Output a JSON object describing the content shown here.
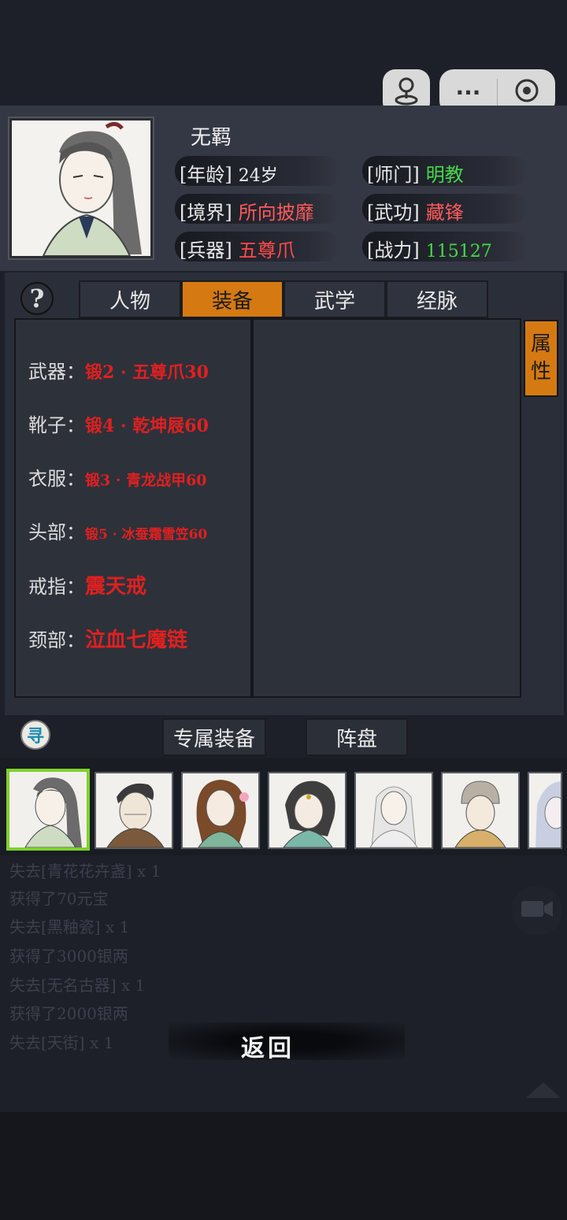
{
  "icons": {
    "location": "location-pin-icon",
    "more": "more-dots-icon",
    "close": "target-circle-icon",
    "help": "question-mark-icon",
    "search": "xun-search-icon",
    "camera": "camera-icon"
  },
  "capsule": {
    "more_glyph": "···"
  },
  "profile": {
    "name": "无羁",
    "rows": [
      {
        "label": "[年龄]",
        "value": "24岁",
        "color": "#f0f0f0"
      },
      {
        "label": "[师门]",
        "value": "明教",
        "color": "#47d84a"
      },
      {
        "label": "[境界]",
        "value": "所向披靡",
        "color": "#ff5a5a"
      },
      {
        "label": "[武功]",
        "value": "藏锋",
        "color": "#ff5a5a"
      },
      {
        "label": "[兵器]",
        "value": "五尊爪",
        "color": "#ff4a4a"
      },
      {
        "label": "[战力]",
        "value": "115127",
        "color": "#47d84a"
      }
    ]
  },
  "help_glyph": "?",
  "tabs": [
    {
      "label": "人物",
      "active": false
    },
    {
      "label": "装备",
      "active": true
    },
    {
      "label": "武学",
      "active": false
    },
    {
      "label": "经脉",
      "active": false
    }
  ],
  "attr_tab": [
    "属",
    "性"
  ],
  "equipment": [
    {
      "label": "武器：",
      "value": "锻2 · 五尊爪30"
    },
    {
      "label": "靴子：",
      "value": "锻4 · 乾坤屐60"
    },
    {
      "label": "衣服：",
      "value": "锻3 · 青龙战甲60"
    },
    {
      "label": "头部：",
      "value": "锻5 · 冰蚕霜雪笠60"
    },
    {
      "label": "戒指：",
      "value": "震天戒"
    },
    {
      "label": "颈部：",
      "value": "泣血七魔链"
    }
  ],
  "search_glyph": "寻",
  "sub_tabs": [
    "专属装备",
    "阵盘"
  ],
  "roster_selected": 0,
  "log": [
    "失去[青花花卉盏] x 1",
    "获得了70元宝",
    "失去[黑釉瓷] x 1",
    "获得了3000银两",
    "失去[无名古器] x 1",
    "获得了2000银两",
    "失去[天街] x 1"
  ],
  "back_label": "返回"
}
